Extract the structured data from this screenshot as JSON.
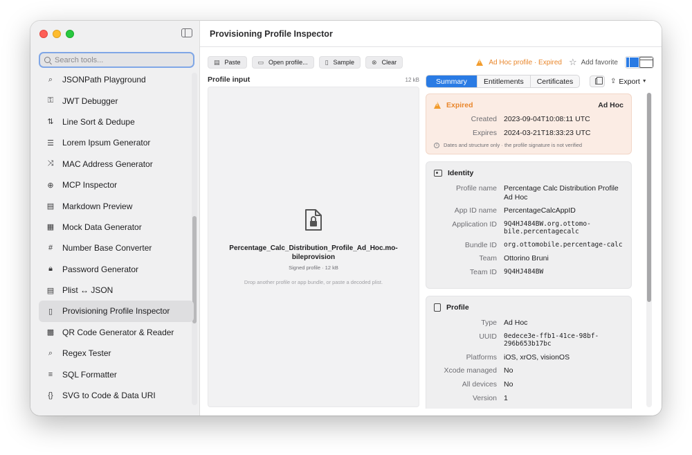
{
  "window_title": "Provisioning Profile Inspector",
  "search": {
    "placeholder": "Search tools..."
  },
  "tools": [
    {
      "label": "JSONPath Playground",
      "icon": "magnifier-code-icon",
      "glyph": "⌕"
    },
    {
      "label": "JWT Debugger",
      "icon": "key-icon",
      "glyph": "⚿"
    },
    {
      "label": "Line Sort & Dedupe",
      "icon": "sort-arrows-icon",
      "glyph": "⇅"
    },
    {
      "label": "Lorem Ipsum Generator",
      "icon": "text-lines-icon",
      "glyph": "☰"
    },
    {
      "label": "MAC Address Generator",
      "icon": "shuffle-icon",
      "glyph": "⤨"
    },
    {
      "label": "MCP Inspector",
      "icon": "globe-icon",
      "glyph": "⊕"
    },
    {
      "label": "Markdown Preview",
      "icon": "document-icon",
      "glyph": "▤"
    },
    {
      "label": "Mock Data Generator",
      "icon": "table-icon",
      "glyph": "▦"
    },
    {
      "label": "Number Base Converter",
      "icon": "hash-icon",
      "glyph": "#"
    },
    {
      "label": "Password Generator",
      "icon": "lock-icon",
      "glyph": "🔒︎"
    },
    {
      "label": "Plist ↔ JSON",
      "icon": "list-icon",
      "glyph": "▤"
    },
    {
      "label": "Provisioning Profile Inspector",
      "icon": "doc-lock-icon",
      "glyph": "▯",
      "active": true
    },
    {
      "label": "QR Code Generator & Reader",
      "icon": "qrcode-icon",
      "glyph": "▩"
    },
    {
      "label": "Regex Tester",
      "icon": "magnifier-icon",
      "glyph": "⌕"
    },
    {
      "label": "SQL Formatter",
      "icon": "align-lines-icon",
      "glyph": "≡"
    },
    {
      "label": "SVG to Code & Data URI",
      "icon": "braces-icon",
      "glyph": "{}"
    }
  ],
  "toolbar": {
    "paste": "Paste",
    "open": "Open profile...",
    "sample": "Sample",
    "clear": "Clear",
    "status": "Ad Hoc profile · Expired",
    "favorite": "Add favorite"
  },
  "input": {
    "label": "Profile input",
    "size": "12 kB",
    "file_name": "Percentage_Calc_Distribution_Profile_Ad_Hoc.mo-bileprovision",
    "file_meta": "Signed profile · 12 kB",
    "hint": "Drop another profile or app bundle, or paste a decoded plist."
  },
  "tabs": [
    "Summary",
    "Entitlements",
    "Certificates"
  ],
  "export_label": "Export",
  "expiry": {
    "status": "Expired",
    "kind": "Ad Hoc",
    "rows": [
      {
        "k": "Created",
        "v": "2023-09-04T10:08:11 UTC"
      },
      {
        "k": "Expires",
        "v": "2024-03-21T18:33:23 UTC"
      }
    ],
    "note": "Dates and structure only · the profile signature is not verified"
  },
  "identity": {
    "title": "Identity",
    "rows": [
      {
        "k": "Profile name",
        "v": "Percentage Calc Distribution Profile Ad Hoc"
      },
      {
        "k": "App ID name",
        "v": "PercentageCalcAppID"
      },
      {
        "k": "Application ID",
        "v": "9Q4HJ484BW.org.ottomo-bile.percentagecalc"
      },
      {
        "k": "Bundle ID",
        "v": "org.ottomobile.percentage-calc"
      },
      {
        "k": "Team",
        "v": "Ottorino Bruni"
      },
      {
        "k": "Team ID",
        "v": "9Q4HJ484BW"
      }
    ]
  },
  "profile": {
    "title": "Profile",
    "rows": [
      {
        "k": "Type",
        "v": "Ad Hoc"
      },
      {
        "k": "UUID",
        "v": "0edece3e-ffb1-41ce-98bf-296b653b17bc"
      },
      {
        "k": "Platforms",
        "v": "iOS, xrOS, visionOS"
      },
      {
        "k": "Xcode managed",
        "v": "No"
      },
      {
        "k": "All devices",
        "v": "No"
      },
      {
        "k": "Version",
        "v": "1"
      }
    ]
  },
  "colors": {
    "accent": "#2a7be4",
    "warning": "#e9862b",
    "expired_bg": "#fbece4"
  }
}
